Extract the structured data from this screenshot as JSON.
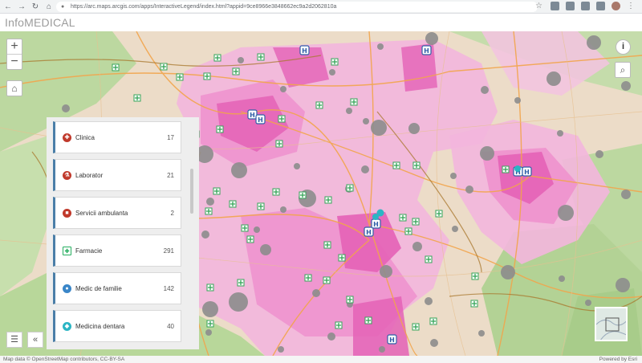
{
  "browser": {
    "url": "https://arc.maps.arcgis.com/apps/InteractiveLegend/index.html?appid=9ce8966e3848662ec9a2d2062810a"
  },
  "app": {
    "title": "InfoMEDICAL"
  },
  "controls": {
    "zoom_in": "+",
    "zoom_out": "−"
  },
  "legend": {
    "items": [
      {
        "label": "Clinica",
        "count": "17",
        "color": "#c0392b",
        "icon": "clinic-icon"
      },
      {
        "label": "Laborator",
        "count": "21",
        "color": "#c0392b",
        "icon": "laboratory-icon"
      },
      {
        "label": "Servicii ambulanta",
        "count": "2",
        "color": "#c0392b",
        "icon": "ambulance-icon"
      },
      {
        "label": "Farmacie",
        "count": "291",
        "color": "#27ae60",
        "icon": "pharmacy-cross-icon"
      },
      {
        "label": "Medic de familie",
        "count": "142",
        "color": "#3a86c8",
        "icon": "family-doctor-icon"
      },
      {
        "label": "Medicina dentara",
        "count": "40",
        "color": "#2bb5c4",
        "icon": "dental-icon"
      }
    ]
  },
  "footer": {
    "attribution": "Map data © OpenStreetMap contributors, CC-BY-SA",
    "powered_by": "Powered by Esri"
  },
  "colors": {
    "land": "#ecdcc8",
    "forest": "#bcd8a0",
    "coverage_light": "#f3b6dd",
    "coverage_mid": "#ee8fcd",
    "coverage_dark": "#e462b6",
    "roads": "#f2a54c",
    "border": "#a8772c",
    "gray_points": "#888888"
  }
}
